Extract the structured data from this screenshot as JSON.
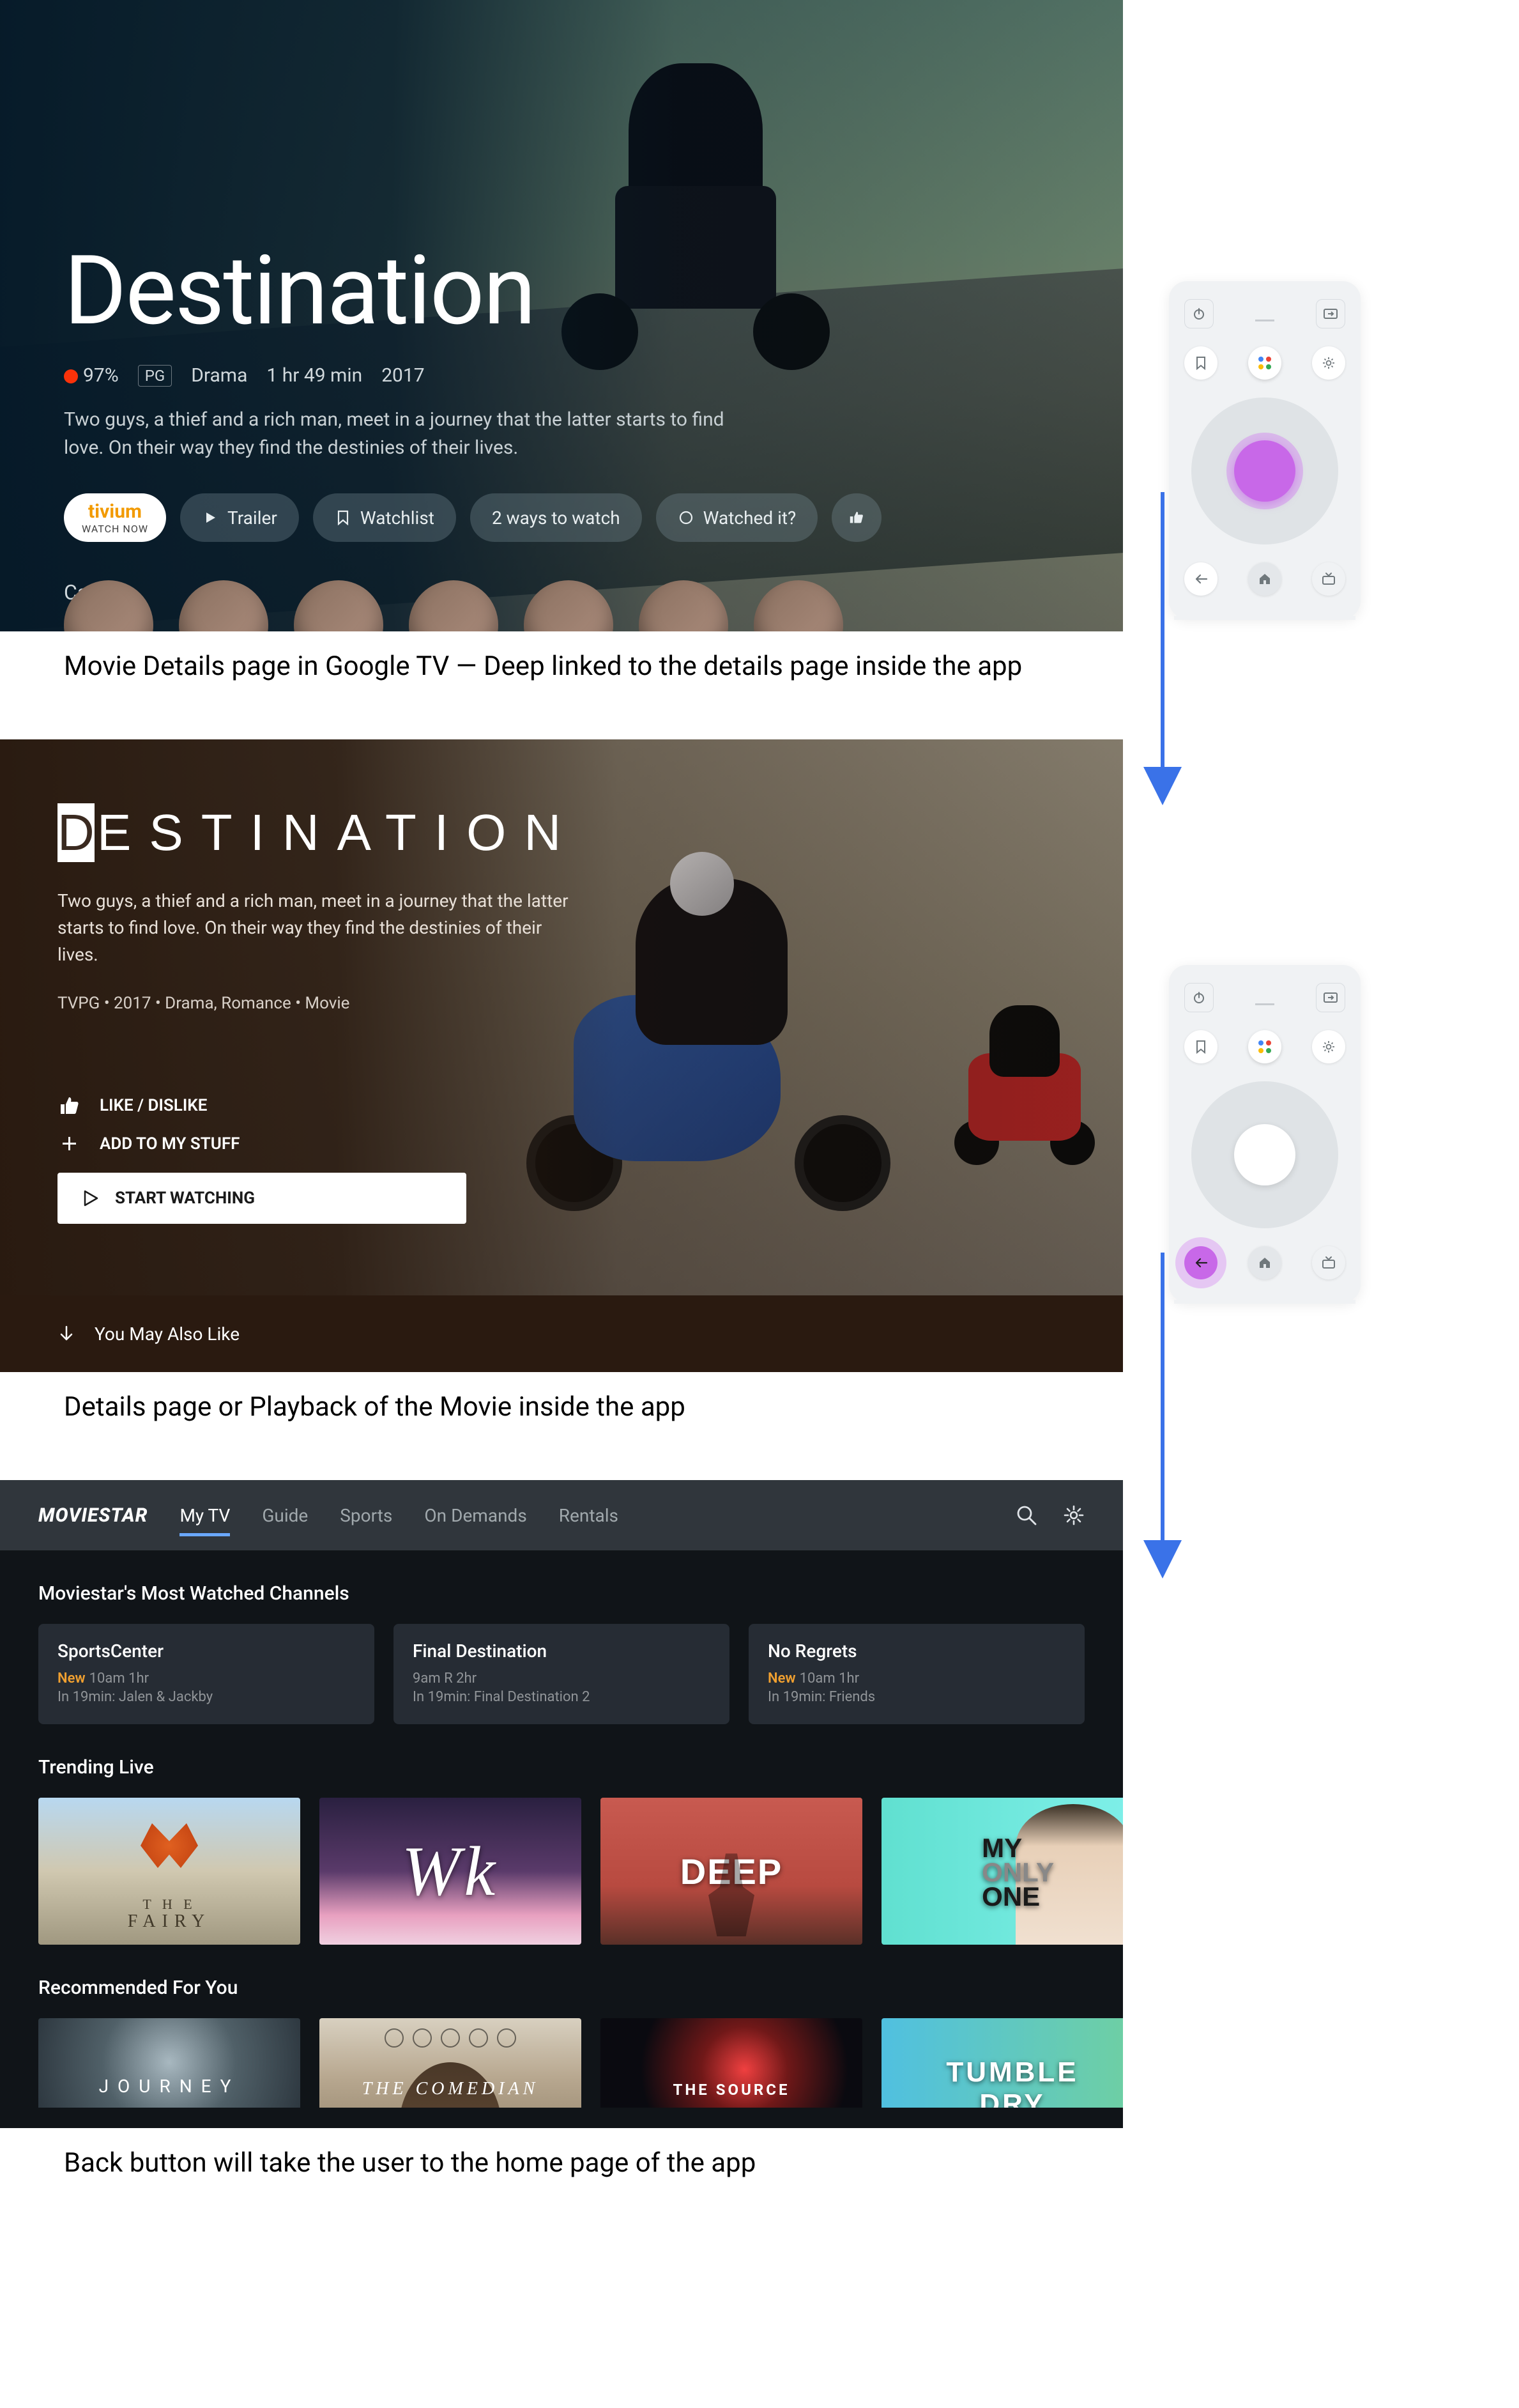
{
  "captions": {
    "s1": "Movie Details page in Google TV — Deep linked to the details page inside the app",
    "s2": "Details page or Playback of the Movie inside the app",
    "s3": "Back button will take the user to the home page of the app"
  },
  "screen1": {
    "title": "Destination",
    "rt_score": "97%",
    "rating_chip": "PG",
    "genre": "Drama",
    "runtime": "1 hr 49 min",
    "year": "2017",
    "description": "Two guys, a thief and a rich man, meet in a journey that the latter starts to find love. On their way they find the destinies of their lives.",
    "primary": {
      "brand": "tivium",
      "sub": "WATCH NOW"
    },
    "buttons": {
      "trailer": "Trailer",
      "watchlist": "Watchlist",
      "ways": "2 ways to watch",
      "watched": "Watched it?"
    },
    "cast_label": "Cast"
  },
  "screen2": {
    "title_first": "D",
    "title_rest": "ESTINATION",
    "description": "Two guys, a thief and a rich man, meet in a journey that the latter starts to find love. On their way they find the destinies of their lives.",
    "meta": "TVPG • 2017 • Drama, Romance • Movie",
    "like": "LIKE / DISLIKE",
    "add": "ADD TO MY STUFF",
    "watch": "START WATCHING",
    "you_may": "You May Also Like"
  },
  "screen3": {
    "logo": "MOVIESTAR",
    "tabs": [
      "My TV",
      "Guide",
      "Sports",
      "On Demands",
      "Rentals"
    ],
    "active_tab": 0,
    "section_channels": "Moviestar's Most Watched Channels",
    "channels": [
      {
        "title": "SportsCenter",
        "new": "New",
        "time": "10am 1hr",
        "next": "In 19min: Jalen & Jackby"
      },
      {
        "title": "Final Destination",
        "new": "",
        "time": "9am R 2hr",
        "next": "In 19min: Final Destination 2"
      },
      {
        "title": "No Regrets",
        "new": "New",
        "time": "10am 1hr",
        "next": "In 19min: Friends"
      }
    ],
    "section_trending": "Trending Live",
    "trending": [
      {
        "label": "FAIRY"
      },
      {
        "label": "Wk"
      },
      {
        "label": "DEEP"
      },
      {
        "label_a": "MY",
        "label_b": "ONE"
      }
    ],
    "section_rec": "Recommended For You",
    "recommended": [
      {
        "label": "JOURNEY"
      },
      {
        "label": "THE COMEDIAN"
      },
      {
        "label": "THE SOURCE"
      },
      {
        "label_a": "TUMBLE",
        "label_b": "DRY"
      }
    ]
  },
  "remote": {
    "assistant_colors": [
      "#4285F4",
      "#EA4335",
      "#FBBC05",
      "#34A853"
    ]
  }
}
